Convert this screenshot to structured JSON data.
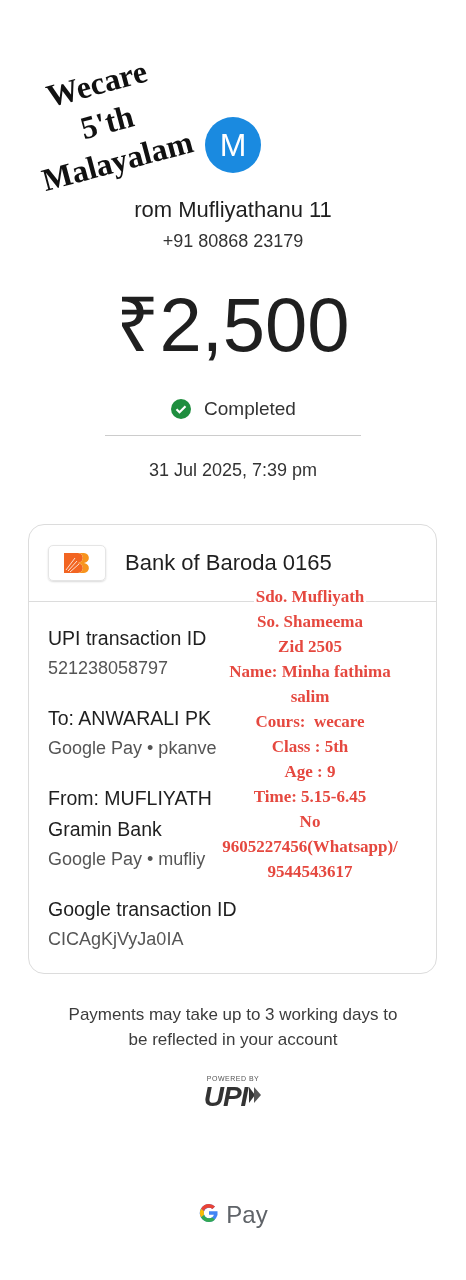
{
  "payer": {
    "avatar_letter": "M",
    "name": "rom Mufliyathanu 11",
    "phone": "+91 80868 23179"
  },
  "amount": "₹2,500",
  "status": {
    "kind": "completed",
    "label": "Completed"
  },
  "date": "31 Jul 2025, 7:39 pm",
  "card": {
    "bank": "Bank of Baroda 0165",
    "rows": [
      {
        "label_lines": [
          "UPI transaction ID"
        ],
        "value": "521238058797"
      },
      {
        "label_lines": [
          "To: ANWARALI PK"
        ],
        "value": "Google Pay • pkanve"
      },
      {
        "label_lines": [
          "From: MUFLIYATH",
          "Gramin Bank"
        ],
        "value": "Google Pay • mufliy"
      },
      {
        "label_lines": [
          "Google transaction ID"
        ],
        "value": "CICAgKjVyJa0IA"
      }
    ]
  },
  "footer_note": "Payments may take up to 3 working days to be reflected in your account",
  "upi": {
    "powered_by": "POWERED BY",
    "logo": "UPI"
  },
  "brand": "Pay",
  "overlays": {
    "stamp": [
      "Wecare",
      "5'th",
      "Malayalam"
    ],
    "note": [
      "Sdo. Mufliyath",
      "So. Shameema",
      "Zid 2505",
      "Name: Minha fathima",
      "salim",
      "Cours:  wecare",
      "Class : 5th",
      "Age : 9",
      "Time: 5.15-6.45",
      "No",
      "9605227456(Whatsapp)/",
      "9544543617"
    ]
  }
}
